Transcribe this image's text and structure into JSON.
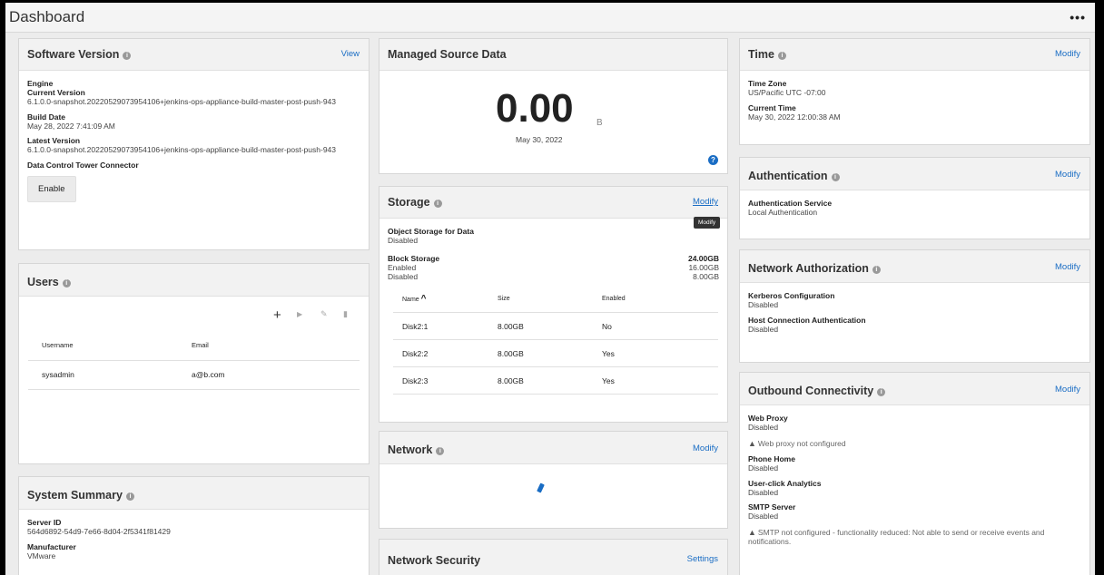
{
  "header": {
    "title": "Dashboard",
    "more_icon": "more-horizontal-icon"
  },
  "software": {
    "title": "Software Version",
    "link": "View",
    "engine_label": "Engine",
    "current_label": "Current Version",
    "current_value": "6.1.0.0-snapshot.20220529073954106+jenkins-ops-appliance-build-master-post-push-943",
    "build_label": "Build Date",
    "build_value": "May 28, 2022 7:41:09 AM",
    "latest_label": "Latest Version",
    "latest_value": "6.1.0.0-snapshot.20220529073954106+jenkins-ops-appliance-build-master-post-push-943",
    "connector_label": "Data Control Tower Connector",
    "enable_button": "Enable"
  },
  "users": {
    "title": "Users",
    "columns": [
      "Username",
      "Email"
    ],
    "rows": [
      {
        "username": "sysadmin",
        "email": "a@b.com"
      }
    ]
  },
  "system_summary": {
    "title": "System Summary",
    "server_label": "Server ID",
    "server_value": "564d6892-54d9-7e66-8d04-2f5341f81429",
    "manufacturer_label": "Manufacturer",
    "manufacturer_value": "VMware"
  },
  "managed": {
    "title": "Managed Source Data",
    "value": "0.00",
    "unit": "B",
    "date": "May 30, 2022"
  },
  "storage": {
    "title": "Storage",
    "link": "Modify",
    "tooltip": "Modify",
    "object_label": "Object Storage for Data",
    "object_value": "Disabled",
    "block_label": "Block Storage",
    "block_total": "24.00GB",
    "enabled_label": "Enabled",
    "enabled_value": "16.00GB",
    "disabled_label": "Disabled",
    "disabled_value": "8.00GB",
    "columns": [
      "Name",
      "Size",
      "Enabled"
    ],
    "disks": [
      {
        "name": "Disk2:1",
        "size": "8.00GB",
        "enabled": "No"
      },
      {
        "name": "Disk2:2",
        "size": "8.00GB",
        "enabled": "Yes"
      },
      {
        "name": "Disk2:3",
        "size": "8.00GB",
        "enabled": "Yes"
      }
    ]
  },
  "network": {
    "title": "Network",
    "link": "Modify"
  },
  "network_security": {
    "title": "Network Security",
    "link": "Settings"
  },
  "time": {
    "title": "Time",
    "link": "Modify",
    "zone_label": "Time Zone",
    "zone_value": "US/Pacific UTC -07:00",
    "current_label": "Current Time",
    "current_value": "May 30, 2022 12:00:38 AM"
  },
  "auth": {
    "title": "Authentication",
    "link": "Modify",
    "service_label": "Authentication Service",
    "service_value": "Local Authentication"
  },
  "netauth": {
    "title": "Network Authorization",
    "link": "Modify",
    "kerberos_label": "Kerberos Configuration",
    "kerberos_value": "Disabled",
    "host_label": "Host Connection Authentication",
    "host_value": "Disabled"
  },
  "outbound": {
    "title": "Outbound Connectivity",
    "link": "Modify",
    "proxy_label": "Web Proxy",
    "proxy_value": "Disabled",
    "proxy_warning": "Web proxy not configured",
    "phone_label": "Phone Home",
    "phone_value": "Disabled",
    "analytics_label": "User-click Analytics",
    "analytics_value": "Disabled",
    "smtp_label": "SMTP Server",
    "smtp_value": "Disabled",
    "smtp_warning": "SMTP not configured - functionality reduced: Not able to send or receive events and notifications."
  }
}
